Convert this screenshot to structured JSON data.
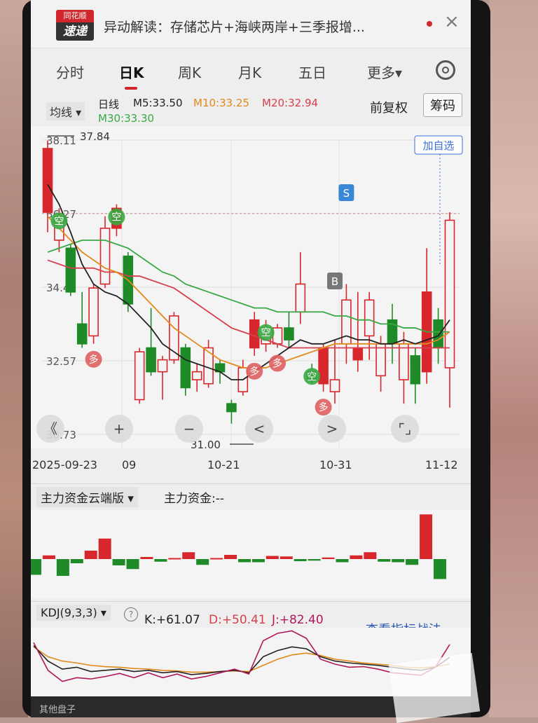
{
  "header": {
    "title": "异动解读：存储芯片+海峡两岸+三季报增...",
    "logo_top": "同花顺",
    "logo_bottom": "速递",
    "close": "×"
  },
  "tabs": [
    "分时",
    "日K",
    "周K",
    "月K",
    "五日",
    "更多▾"
  ],
  "ma": {
    "selector": "均线 ▾",
    "label": "日线",
    "ma5": "M5:33.50",
    "ma10": "M10:33.25",
    "ma20": "M20:32.94",
    "ma30": "M30:33.30",
    "adjust": "前复权",
    "chips": "筹码"
  },
  "colors": {
    "up": "#d7262c",
    "down": "#1f8a28",
    "ma5": "#222222",
    "ma10": "#e08a1c",
    "ma20": "#d6404e",
    "ma30": "#3aa843"
  },
  "chart_data": {
    "type": "candlestick",
    "y_ticks": [
      "38.11",
      "36.27",
      "34.42",
      "32.57",
      "30.73"
    ],
    "y_range": [
      30.73,
      38.11
    ],
    "max_label": "37.84",
    "min_label": "31.00",
    "last_close_label": "36.27",
    "x_labels": [
      "2025-09-23",
      "09",
      "10-21",
      "10-31",
      "11-12"
    ],
    "add_watch_label": "加自选",
    "signals": [
      {
        "text": "S",
        "bar": 26
      },
      {
        "text": "B",
        "bar": 25
      }
    ],
    "tags": [
      {
        "text": "空",
        "bar": 1
      },
      {
        "text": "空",
        "bar": 6
      },
      {
        "text": "空",
        "bar": 19
      },
      {
        "text": "空",
        "bar": 23
      },
      {
        "text": "多",
        "bar": 4
      },
      {
        "text": "多",
        "bar": 18
      },
      {
        "text": "多",
        "bar": 20
      },
      {
        "text": "多",
        "bar": 24
      }
    ],
    "candles": [
      {
        "o": 36.3,
        "c": 37.9,
        "h": 38.1,
        "l": 35.8
      },
      {
        "o": 35.6,
        "c": 36.1,
        "h": 36.4,
        "l": 35.3
      },
      {
        "o": 35.4,
        "c": 34.3,
        "h": 35.5,
        "l": 34.2
      },
      {
        "o": 33.5,
        "c": 33.0,
        "h": 34.3,
        "l": 32.9
      },
      {
        "o": 33.2,
        "c": 34.4,
        "h": 34.5,
        "l": 33.0
      },
      {
        "o": 34.5,
        "c": 35.9,
        "h": 36.2,
        "l": 34.4
      },
      {
        "o": 35.9,
        "c": 36.4,
        "h": 36.5,
        "l": 35.7
      },
      {
        "o": 35.2,
        "c": 34.0,
        "h": 35.3,
        "l": 33.8
      },
      {
        "o": 31.6,
        "c": 32.8,
        "h": 32.9,
        "l": 31.5
      },
      {
        "o": 32.9,
        "c": 32.3,
        "h": 33.9,
        "l": 32.2
      },
      {
        "o": 32.3,
        "c": 32.6,
        "h": 32.7,
        "l": 31.6
      },
      {
        "o": 32.6,
        "c": 33.7,
        "h": 33.8,
        "l": 32.5
      },
      {
        "o": 32.9,
        "c": 31.9,
        "h": 33.0,
        "l": 31.7
      },
      {
        "o": 32.1,
        "c": 32.3,
        "h": 32.5,
        "l": 31.8
      },
      {
        "o": 32.0,
        "c": 32.9,
        "h": 33.1,
        "l": 31.9
      },
      {
        "o": 32.5,
        "c": 32.3,
        "h": 32.6,
        "l": 32.0
      },
      {
        "o": 31.5,
        "c": 31.3,
        "h": 31.6,
        "l": 31.0
      },
      {
        "o": 31.8,
        "c": 32.4,
        "h": 32.6,
        "l": 31.7
      },
      {
        "o": 32.9,
        "c": 33.6,
        "h": 33.8,
        "l": 32.7
      },
      {
        "o": 33.0,
        "c": 33.2,
        "h": 33.6,
        "l": 32.8
      },
      {
        "o": 33.0,
        "c": 33.4,
        "h": 33.5,
        "l": 32.9
      },
      {
        "o": 33.4,
        "c": 33.1,
        "h": 33.8,
        "l": 32.9
      },
      {
        "o": 33.8,
        "c": 34.5,
        "h": 35.3,
        "l": 33.5
      },
      {
        "o": 32.3,
        "c": 32.1,
        "h": 32.5,
        "l": 32.0
      },
      {
        "o": 32.0,
        "c": 32.9,
        "h": 33.0,
        "l": 31.8
      },
      {
        "o": 31.8,
        "c": 32.1,
        "h": 33.1,
        "l": 31.5
      },
      {
        "o": 33.0,
        "c": 34.1,
        "h": 34.5,
        "l": 32.5
      },
      {
        "o": 32.6,
        "c": 32.9,
        "h": 34.3,
        "l": 32.3
      },
      {
        "o": 33.2,
        "c": 34.1,
        "h": 34.3,
        "l": 32.6
      },
      {
        "o": 32.2,
        "c": 33.0,
        "h": 33.2,
        "l": 31.8
      },
      {
        "o": 33.6,
        "c": 33.0,
        "h": 34.0,
        "l": 32.5
      },
      {
        "o": 32.1,
        "c": 33.0,
        "h": 33.3,
        "l": 31.5
      },
      {
        "o": 32.7,
        "c": 32.0,
        "h": 32.9,
        "l": 31.5
      },
      {
        "o": 32.3,
        "c": 34.3,
        "h": 35.4,
        "l": 32.0
      },
      {
        "o": 33.6,
        "c": 32.9,
        "h": 33.9,
        "l": 32.5
      },
      {
        "o": 32.4,
        "c": 36.1,
        "h": 36.3,
        "l": 31.4
      }
    ],
    "ma5": [
      37.0,
      36.5,
      35.8,
      35.0,
      34.5,
      34.3,
      34.2,
      34.0,
      33.7,
      33.4,
      33.0,
      32.8,
      32.6,
      32.5,
      32.4,
      32.3,
      32.1,
      32.1,
      32.3,
      32.5,
      32.7,
      32.9,
      33.1,
      33.0,
      33.0,
      33.1,
      33.2,
      33.1,
      33.1,
      33.0,
      33.0,
      33.1,
      33.0,
      33.1,
      33.2,
      33.6
    ],
    "ma10": [
      36.2,
      35.9,
      35.6,
      35.3,
      35.1,
      34.9,
      34.8,
      34.6,
      34.3,
      34.0,
      33.7,
      33.4,
      33.2,
      33.0,
      32.8,
      32.6,
      32.5,
      32.4,
      32.4,
      32.4,
      32.5,
      32.6,
      32.7,
      32.8,
      32.9,
      33.0,
      33.0,
      33.0,
      33.0,
      33.0,
      33.0,
      33.0,
      33.0,
      33.0,
      33.1,
      33.3
    ],
    "ma20": [
      35.1,
      35.0,
      34.9,
      34.9,
      34.9,
      34.8,
      34.8,
      34.7,
      34.7,
      34.6,
      34.5,
      34.4,
      34.2,
      34.0,
      33.8,
      33.6,
      33.4,
      33.3,
      33.2,
      33.1,
      33.0,
      32.9,
      32.9,
      32.9,
      32.9,
      32.9,
      32.9,
      32.9,
      32.9,
      32.9,
      32.9,
      32.9,
      32.9,
      32.9,
      32.9,
      32.9
    ],
    "ma30": [
      35.3,
      35.4,
      35.5,
      35.6,
      35.6,
      35.6,
      35.5,
      35.4,
      35.2,
      35.0,
      34.8,
      34.7,
      34.5,
      34.4,
      34.3,
      34.2,
      34.1,
      34.0,
      33.9,
      33.9,
      33.8,
      33.8,
      33.8,
      33.8,
      33.8,
      33.7,
      33.7,
      33.6,
      33.6,
      33.5,
      33.5,
      33.4,
      33.4,
      33.3,
      33.3,
      33.3
    ],
    "money_flow": [
      -3,
      0.7,
      -3.2,
      -0.8,
      1.6,
      3.9,
      -1.2,
      -1.9,
      0.4,
      -0.5,
      0.2,
      1.3,
      -1.1,
      0.2,
      0.8,
      -0.6,
      -0.6,
      0.6,
      0.5,
      -0.4,
      -0.3,
      0.3,
      -0.6,
      0.7,
      1.3,
      -0.5,
      -0.6,
      -1.1,
      8.5,
      -3.8
    ],
    "kdj_k": [
      80,
      55,
      42,
      45,
      38,
      40,
      42,
      38,
      40,
      36,
      38,
      33,
      35,
      38,
      40,
      36,
      62,
      72,
      78,
      75,
      62,
      55,
      52,
      50,
      48,
      45,
      42,
      40,
      45,
      61
    ],
    "kdj_d": [
      78,
      62,
      55,
      52,
      48,
      46,
      45,
      43,
      42,
      40,
      39,
      37,
      37,
      38,
      39,
      38,
      48,
      58,
      65,
      68,
      64,
      58,
      55,
      52,
      50,
      48,
      45,
      44,
      46,
      50
    ],
    "kdj_j": [
      85,
      40,
      22,
      28,
      26,
      30,
      35,
      28,
      36,
      28,
      34,
      26,
      30,
      36,
      42,
      34,
      88,
      100,
      104,
      92,
      58,
      50,
      45,
      46,
      42,
      36,
      34,
      32,
      45,
      82
    ]
  },
  "nav": {
    "back": "《",
    "zoom_in": "+",
    "zoom_out": "−",
    "prev": "<",
    "next": ">",
    "fullscreen": "⌜⌟"
  },
  "money_flow": {
    "selector": "主力资金云端版 ▾",
    "label": "主力资金:--"
  },
  "kdj": {
    "selector": "KDJ(9,3,3) ▾",
    "k": "K:+61.07",
    "d": "D:+50.41",
    "j": "J:+82.40",
    "link": "查看指标战法"
  },
  "bottom": {
    "label": "其他盘子"
  }
}
